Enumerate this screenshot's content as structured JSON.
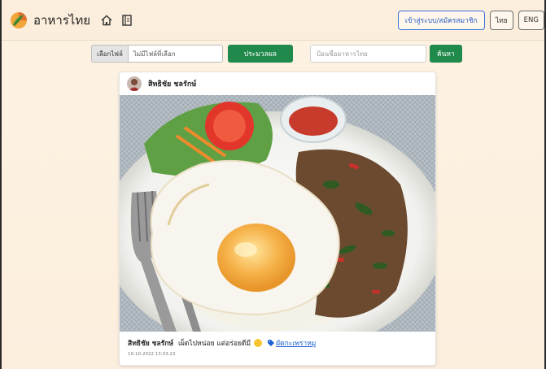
{
  "navbar": {
    "brand": "อาหารไทย",
    "login_label": "เข้าสู่ระบบ/สมัครสมาชิก",
    "lang_th": "ไทย",
    "lang_en": "ENG"
  },
  "upload": {
    "choose_label": "เลือกไฟล์",
    "file_status": "ไม่มีไฟล์ที่เลือก",
    "process_label": "ประมวลผล"
  },
  "search": {
    "placeholder": "ป้อนชื่ออาหารไทย",
    "button_label": "ค้นหา"
  },
  "post": {
    "author": "สิทธิชัย ชลรักษ์",
    "caption": "เผ็ดไปหน่อย แต่อร่อยดีมี",
    "tag": "ผัดกะเพราหมู",
    "timestamp": "19-10-2022 13:03:23"
  },
  "colors": {
    "accent_green": "#1f8a4c",
    "link_blue": "#1a5fd0",
    "background": "#fbeedd"
  }
}
